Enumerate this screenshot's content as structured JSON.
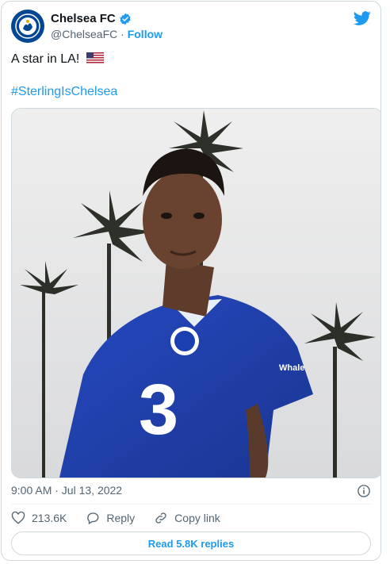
{
  "author": {
    "display_name": "Chelsea FC",
    "handle": "@ChelseaFC",
    "separator": "·",
    "follow_label": "Follow",
    "verified": true,
    "avatar_icon": "chelsea-crest-icon",
    "brand_color": "#034694"
  },
  "tweet": {
    "text": "A star in LA!",
    "flag_icon": "us-flag-icon",
    "hashtag": "#SterlingIsChelsea",
    "timestamp": "9:00 AM · Jul 13, 2022"
  },
  "media": {
    "shirt_sponsor": "Whale"
  },
  "actions": {
    "likes": "213.6K",
    "reply_label": "Reply",
    "copy_link_label": "Copy link",
    "read_replies_label": "Read 5.8K replies"
  },
  "colors": {
    "accent": "#1d9bf0",
    "muted": "#536471",
    "kit_blue": "#1a3fb0"
  }
}
